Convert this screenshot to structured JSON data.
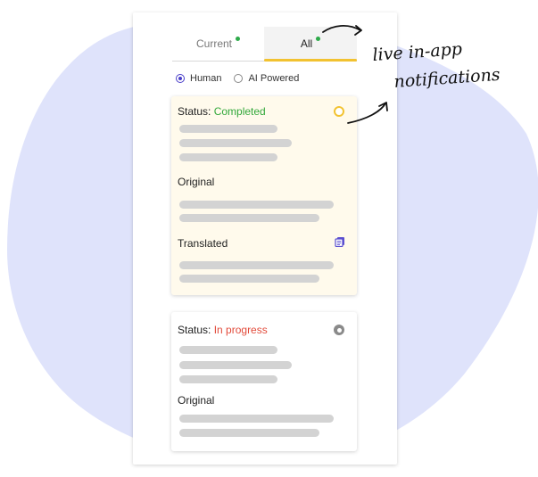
{
  "tabs": [
    {
      "label": "Current",
      "active": false
    },
    {
      "label": "All",
      "active": true
    }
  ],
  "filters": [
    {
      "label": "Human",
      "selected": true
    },
    {
      "label": "AI Powered",
      "selected": false
    }
  ],
  "cards": [
    {
      "status_label": "Status:",
      "status_value": "Completed",
      "status_color": "#32a83a",
      "indicator_color": "#f2c230",
      "original_label": "Original",
      "translated_label": "Translated"
    },
    {
      "status_label": "Status:",
      "status_value": "In progress",
      "status_color": "#e24b3b",
      "indicator_color": "#8a8a8a",
      "original_label": "Original"
    }
  ],
  "annotation": {
    "line1": "live in-app",
    "line2": "notifications"
  },
  "colors": {
    "blob": "#dfe3fb",
    "tab_indicator": "#f2c230",
    "tab_dot": "#2eaa4a",
    "radio_selected": "#4a3fc9",
    "card_highlight": "#fffaec",
    "doc_icon": "#5b4fd0"
  }
}
